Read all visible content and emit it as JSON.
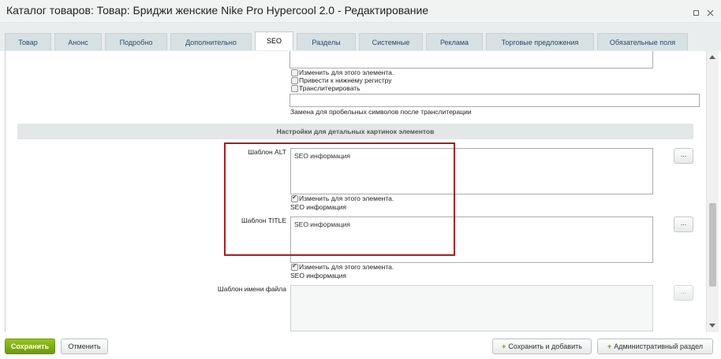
{
  "window": {
    "title": "Каталог товаров: Товар: Бриджи женские Nike Pro Hypercool 2.0 - Редактирование"
  },
  "tabs": [
    {
      "label": "Товар"
    },
    {
      "label": "Анонс"
    },
    {
      "label": "Подробно"
    },
    {
      "label": "Дополнительно"
    },
    {
      "label": "SEO"
    },
    {
      "label": "Разделы"
    },
    {
      "label": "Системные"
    },
    {
      "label": "Реклама"
    },
    {
      "label": "Торговые предложения"
    },
    {
      "label": "Обязательные поля"
    }
  ],
  "active_tab": "SEO",
  "top_options": {
    "change_for_element": "Изменить для этого элемента.",
    "lowercase": "Привести к нижнему регистру",
    "transliterate": "Транслитерировать",
    "replace_hint": "Замена для пробельных символов после транслитерации",
    "replace_value": ""
  },
  "section_title": "Настройки для детальных картинок элементов",
  "fields": {
    "alt": {
      "label": "Шаблон ALT",
      "value": "SEO информация",
      "checkbox_label": "Изменить для этого элемента.",
      "checked": true,
      "hint": "SEO информация",
      "button": "..."
    },
    "title": {
      "label": "Шаблон TITLE",
      "value": "SEO информация",
      "checkbox_label": "Изменить для этого элемента.",
      "checked": true,
      "hint": "SEO информация",
      "button": "..."
    },
    "filename": {
      "label": "Шаблон имени файла",
      "value": "",
      "button": "..."
    }
  },
  "footer": {
    "save": "Сохранить",
    "cancel": "Отменить",
    "save_and_add": "Сохранить и добавить",
    "admin_section": "Административный раздел"
  },
  "colors": {
    "save_button": "#7cab12",
    "highlight_box": "#b11a1a"
  }
}
